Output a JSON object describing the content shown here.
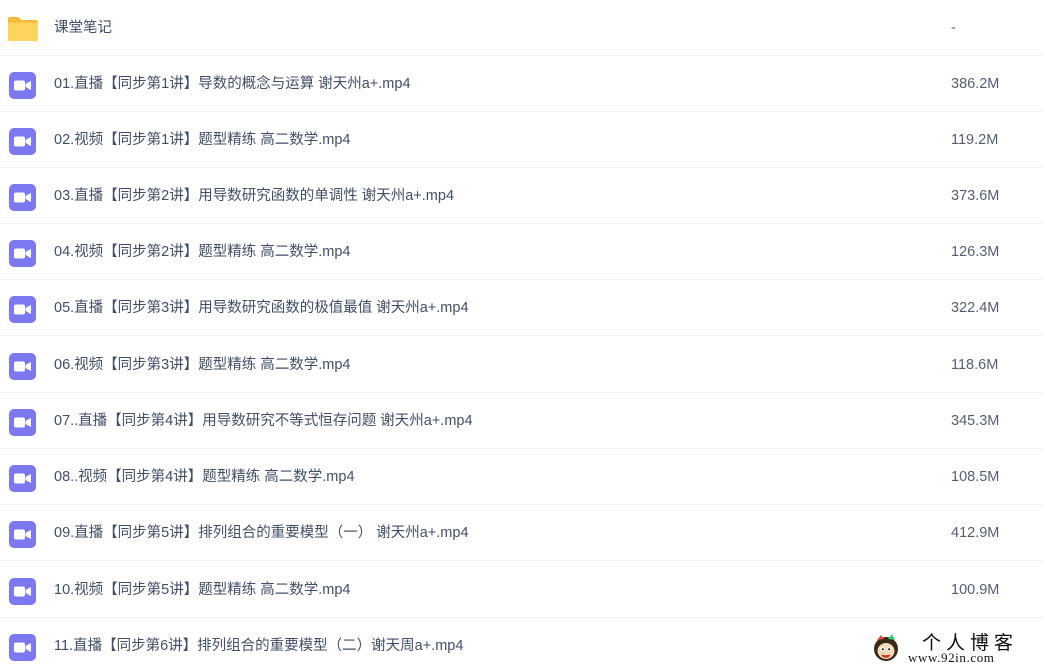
{
  "files": [
    {
      "type": "folder",
      "icon": "folder-icon",
      "name": "课堂笔记",
      "size": "-"
    },
    {
      "type": "video",
      "icon": "video-file-icon",
      "name": "01.直播【同步第1讲】导数的概念与运算 谢天州a+.mp4",
      "size": "386.2M"
    },
    {
      "type": "video",
      "icon": "video-file-icon",
      "name": "02.视频【同步第1讲】题型精练 高二数学.mp4",
      "size": "119.2M"
    },
    {
      "type": "video",
      "icon": "video-file-icon",
      "name": "03.直播【同步第2讲】用导数研究函数的单调性 谢天州a+.mp4",
      "size": "373.6M"
    },
    {
      "type": "video",
      "icon": "video-file-icon",
      "name": "04.视频【同步第2讲】题型精练 高二数学.mp4",
      "size": "126.3M"
    },
    {
      "type": "video",
      "icon": "video-file-icon",
      "name": "05.直播【同步第3讲】用导数研究函数的极值最值 谢天州a+.mp4",
      "size": "322.4M"
    },
    {
      "type": "video",
      "icon": "video-file-icon",
      "name": "06.视频【同步第3讲】题型精练 高二数学.mp4",
      "size": "118.6M"
    },
    {
      "type": "video",
      "icon": "video-file-icon",
      "name": "07..直播【同步第4讲】用导数研究不等式恒存问题 谢天州a+.mp4",
      "size": "345.3M"
    },
    {
      "type": "video",
      "icon": "video-file-icon",
      "name": "08..视频【同步第4讲】题型精练 高二数学.mp4",
      "size": "108.5M"
    },
    {
      "type": "video",
      "icon": "video-file-icon",
      "name": "09.直播【同步第5讲】排列组合的重要模型（一） 谢天州a+.mp4",
      "size": "412.9M"
    },
    {
      "type": "video",
      "icon": "video-file-icon",
      "name": "10.视频【同步第5讲】题型精练 高二数学.mp4",
      "size": "100.9M"
    },
    {
      "type": "video",
      "icon": "video-file-icon",
      "name": "11.直播【同步第6讲】排列组合的重要模型（二）谢天周a+.mp4",
      "size": ""
    }
  ],
  "watermark": {
    "title": "个人博客",
    "url": "www.92in.com",
    "icon": "mascot-icon"
  },
  "colors": {
    "folder": "#ffc94d",
    "video_icon": "#7b78f0",
    "text": "#424e67",
    "divider": "#f1f2f5"
  }
}
